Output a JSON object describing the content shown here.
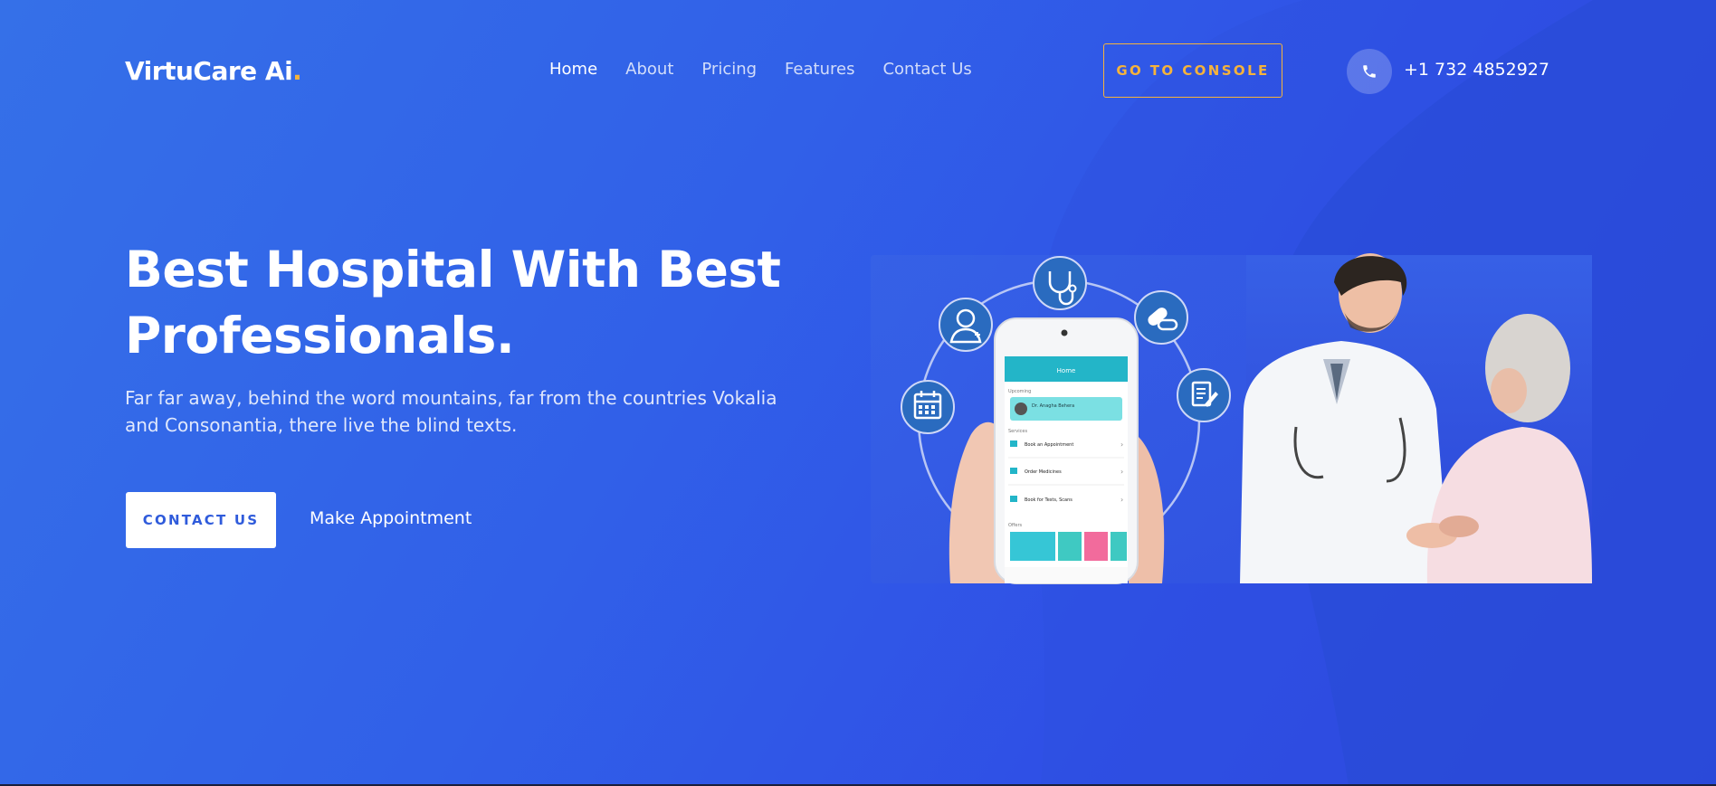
{
  "brand": {
    "name": "VirtuCare Ai",
    "dot": ".",
    "accent_color": "#f6b33b"
  },
  "nav": {
    "items": [
      {
        "label": "Home",
        "active": true
      },
      {
        "label": "About"
      },
      {
        "label": "Pricing"
      },
      {
        "label": "Features"
      },
      {
        "label": "Contact Us"
      }
    ]
  },
  "header": {
    "console_label": "GO TO CONSOLE",
    "phone_icon": "phone-icon",
    "phone": "+1 732 4852927"
  },
  "hero": {
    "title_line1": "Best Hospital With Best",
    "title_line2": "Professionals.",
    "description": "Far far away, behind the word mountains, far from the countries Vokalia and Consonantia, there live the blind texts.",
    "contact_label": "CONTACT US",
    "appointment_label": "Make Appointment"
  },
  "illustration": {
    "app_header": "Home",
    "upcoming_label": "Upcoming",
    "doctor_name": "Dr. Anagha Behera",
    "services_label": "Services",
    "services": [
      "Book an Appointment",
      "Order Medicines",
      "Book for Tests, Scans"
    ],
    "offers_label": "Offers",
    "icons": [
      "stethoscope-icon",
      "doctor-icon",
      "pill-icon",
      "calendar-icon",
      "prescription-icon"
    ]
  },
  "colors": {
    "background": "#3160e8",
    "button_text": "#2f5bdb",
    "circle_icon": "#2a6bbf"
  }
}
